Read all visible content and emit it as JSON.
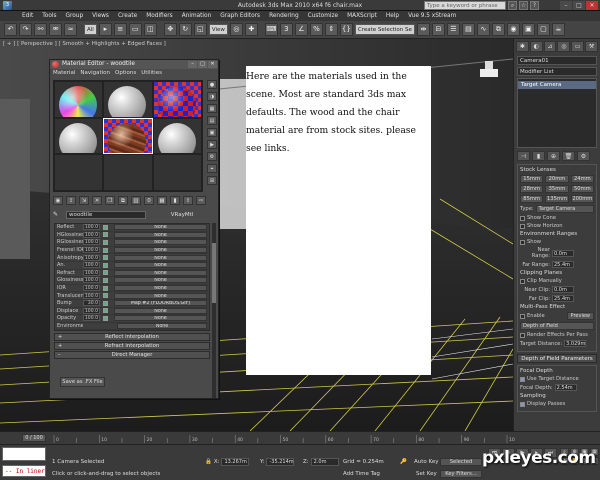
{
  "window": {
    "title": "Autodesk 3ds Max  2010 x64        f6 chair.max",
    "search_placeholder": "Type a keyword or phrase"
  },
  "menu": [
    "Edit",
    "Tools",
    "Group",
    "Views",
    "Create",
    "Modifiers",
    "Animation",
    "Graph Editors",
    "Rendering",
    "Customize",
    "MAXScript",
    "Help",
    "Vue 9.5 xStream"
  ],
  "toolbar": {
    "selection_filter": "All",
    "view_dropdown": "View",
    "named_selection": "Create Selection Se"
  },
  "viewport": {
    "label": "[ + ] [ Perspective ] [ Smooth + Highlights + Edged Faces ]"
  },
  "material_editor": {
    "title": "Material Editor - woodtile",
    "menu": [
      "Material",
      "Navigation",
      "Options",
      "Utilities"
    ],
    "material_name": "woodtile",
    "material_type": "VRayMtl",
    "maps": [
      {
        "label": "Reflect",
        "value": "100.0",
        "map": "None"
      },
      {
        "label": "HGlossiness",
        "value": "100.0",
        "map": "None"
      },
      {
        "label": "RGlossiness",
        "value": "100.0",
        "map": "None"
      },
      {
        "label": "Fresnel IOR",
        "value": "100.0",
        "map": "None"
      },
      {
        "label": "Anisotropy",
        "value": "100.0",
        "map": "None"
      },
      {
        "label": "An.",
        "value": "100.0",
        "map": "None"
      },
      {
        "label": "Refract",
        "value": "100.0",
        "map": "None"
      },
      {
        "label": "Glossiness",
        "value": "100.0",
        "map": "None"
      },
      {
        "label": "IOR",
        "value": "100.0",
        "map": "None"
      },
      {
        "label": "Translucent",
        "value": "100.0",
        "map": "None"
      },
      {
        "label": "Bump",
        "value": "30.0",
        "map": "Map #2 (FLOORBDS.GIF)"
      },
      {
        "label": "Displace",
        "value": "100.0",
        "map": "None"
      },
      {
        "label": "Opacity",
        "value": "100.0",
        "map": "None"
      },
      {
        "label": "Environment",
        "value": "",
        "map": "None"
      }
    ],
    "rollouts": [
      "Reflect interpolation",
      "Refract interpolation",
      "Direct Manager"
    ],
    "save_button": "Save as .FX File"
  },
  "note": {
    "text": "Here are the materials used in the\nscene. Most are standard 3ds max\ndefaults. The wood and the chair\nmaterial are from stock sites. please\nsee links."
  },
  "command_panel": {
    "object_name": "Camera01",
    "modifier_list": "Modifier List",
    "stack_item": "Target Camera",
    "stock_lenses_title": "Stock Lenses",
    "lenses": [
      "15mm",
      "20mm",
      "24mm",
      "28mm",
      "35mm",
      "50mm",
      "85mm",
      "135mm",
      "200mm"
    ],
    "type_label": "Type:",
    "type_value": "Target Camera",
    "show_cone": "Show Cone",
    "show_horizon": "Show Horizon",
    "env_ranges_title": "Environment Ranges",
    "show": "Show",
    "near_range_label": "Near Range:",
    "near_range_value": "0.0m",
    "far_range_label": "Far Range:",
    "far_range_value": "25.4m",
    "clipping_title": "Clipping Planes",
    "clip_manually": "Clip Manually",
    "near_clip_label": "Near Clip:",
    "near_clip_value": "0.0m",
    "far_clip_label": "Far Clip:",
    "far_clip_value": "25.4m",
    "multipass_title": "Multi-Pass Effect",
    "enable": "Enable",
    "preview": "Preview",
    "effect_value": "Depth of Field",
    "render_effects": "Render Effects Per Pass",
    "target_distance_label": "Target Distance:",
    "target_distance_value": "3.029m",
    "dof_params_title": "Depth of Field Parameters",
    "focal_depth_title": "Focal Depth",
    "use_target_distance": "Use Target Distance",
    "focal_depth_label": "Focal Depth:",
    "focal_depth_value": "2.54m",
    "sampling_title": "Sampling",
    "display_passes": "Display Passes"
  },
  "timeline": {
    "slider_label": "0 / 100",
    "ticks": [
      "0",
      "10",
      "20",
      "30",
      "40",
      "50",
      "60",
      "70",
      "80",
      "90",
      "100"
    ]
  },
  "status": {
    "maxscript_text": "-- In liner",
    "selection": "1 Camera Selected",
    "prompt": "Click or click-and-drag to select objects",
    "x_label": "X:",
    "x_value": "13.267m",
    "y_label": "Y:",
    "y_value": "-35.214m",
    "z_label": "Z:",
    "z_value": "2.0m",
    "grid": "Grid = 0.254m",
    "add_time_tag": "Add Time Tag",
    "auto_key": "Auto Key",
    "set_key": "Set Key",
    "selected": "Selected",
    "key_filters": "Key Filters..."
  },
  "watermark": "pxleyes.com"
}
